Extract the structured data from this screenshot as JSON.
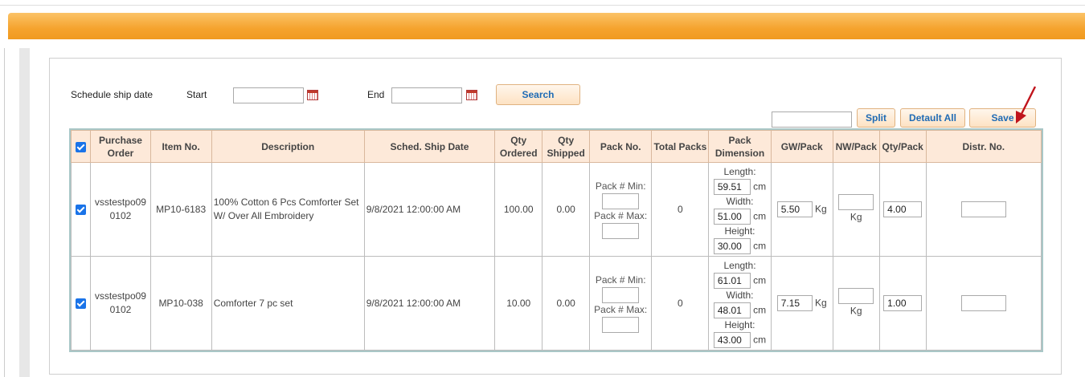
{
  "filters": {
    "schedule_label": "Schedule ship date",
    "start_label": "Start",
    "end_label": "End",
    "start_value": "",
    "end_value": "",
    "search_label": "Search"
  },
  "actions": {
    "split_value": "",
    "split_label": "Split",
    "default_all_label": "Detault All",
    "save_label": "Save"
  },
  "table": {
    "headers": {
      "purchase_order": "Purchase Order",
      "item_no": "Item No.",
      "description": "Description",
      "sched_ship_date": "Sched. Ship Date",
      "qty_ordered": "Qty Ordered",
      "qty_shipped": "Qty Shipped",
      "pack_no": "Pack No.",
      "total_packs": "Total Packs",
      "pack_dimension": "Pack Dimension",
      "gw_pack": "GW/Pack",
      "nw_pack": "NW/Pack",
      "qty_pack": "Qty/Pack",
      "distr_no": "Distr. No."
    },
    "labels": {
      "pack_min": "Pack # Min:",
      "pack_max": "Pack # Max:",
      "length": "Length:",
      "width": "Width:",
      "height": "Height:",
      "cm": "cm",
      "kg": "Kg"
    },
    "rows": [
      {
        "checked": true,
        "purchase_order": "vsstestpo090102",
        "item_no": "MP10-6183",
        "description": "100% Cotton 6 Pcs Comforter Set W/ Over All Embroidery",
        "sched_ship_date": "9/8/2021 12:00:00 AM",
        "qty_ordered": "100.00",
        "qty_shipped": "0.00",
        "total_packs": "0",
        "length": "59.51",
        "width": "51.00",
        "height": "30.00",
        "gw_pack": "5.50",
        "nw_pack": "",
        "qty_pack": "4.00",
        "distr_no": ""
      },
      {
        "checked": true,
        "purchase_order": "vsstestpo090102",
        "item_no": "MP10-038",
        "description": "Comforter 7 pc set",
        "sched_ship_date": "9/8/2021 12:00:00 AM",
        "qty_ordered": "10.00",
        "qty_shipped": "0.00",
        "total_packs": "0",
        "length": "61.01",
        "width": "48.01",
        "height": "43.00",
        "gw_pack": "7.15",
        "nw_pack": "",
        "qty_pack": "1.00",
        "distr_no": ""
      }
    ]
  },
  "colors": {
    "header_bar": "#f5a32d",
    "button_text": "#1f6bb5",
    "table_header_bg": "#fde9d9",
    "checkbox": "#1a73e8",
    "annotation_arrow": "#c0141c"
  },
  "icons": [
    "calendar-icon",
    "checkbox-checked-icon",
    "annotation-arrow-icon"
  ]
}
